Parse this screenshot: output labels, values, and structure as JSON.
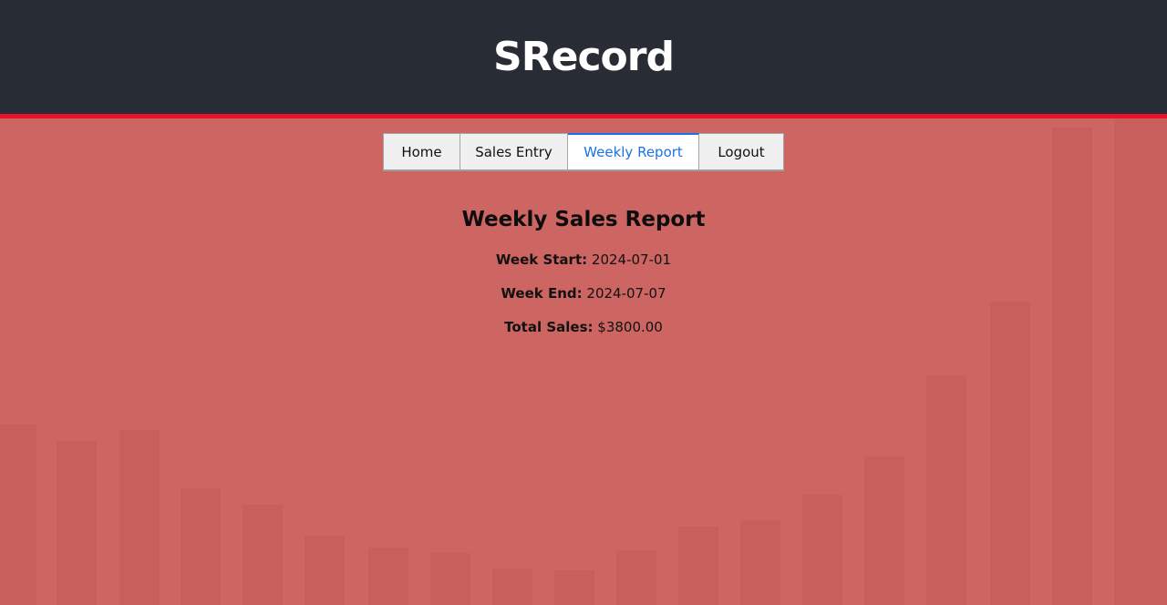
{
  "app": {
    "title": "SRecord"
  },
  "nav": {
    "tabs": [
      {
        "label": "Home"
      },
      {
        "label": "Sales Entry"
      },
      {
        "label": "Weekly Report",
        "active": true
      },
      {
        "label": "Logout"
      }
    ]
  },
  "report": {
    "heading": "Weekly Sales Report",
    "week_start_label": "Week Start:",
    "week_start": "2024-07-01",
    "week_end_label": "Week End:",
    "week_end": "2024-07-07",
    "total_sales_label": "Total Sales:",
    "total_sales": "$3800.00"
  },
  "colors": {
    "header_bg": "#282c35",
    "accent_line": "#e8132b",
    "page_bg": "#cd6562",
    "active_tab_text": "#1a73e8"
  }
}
